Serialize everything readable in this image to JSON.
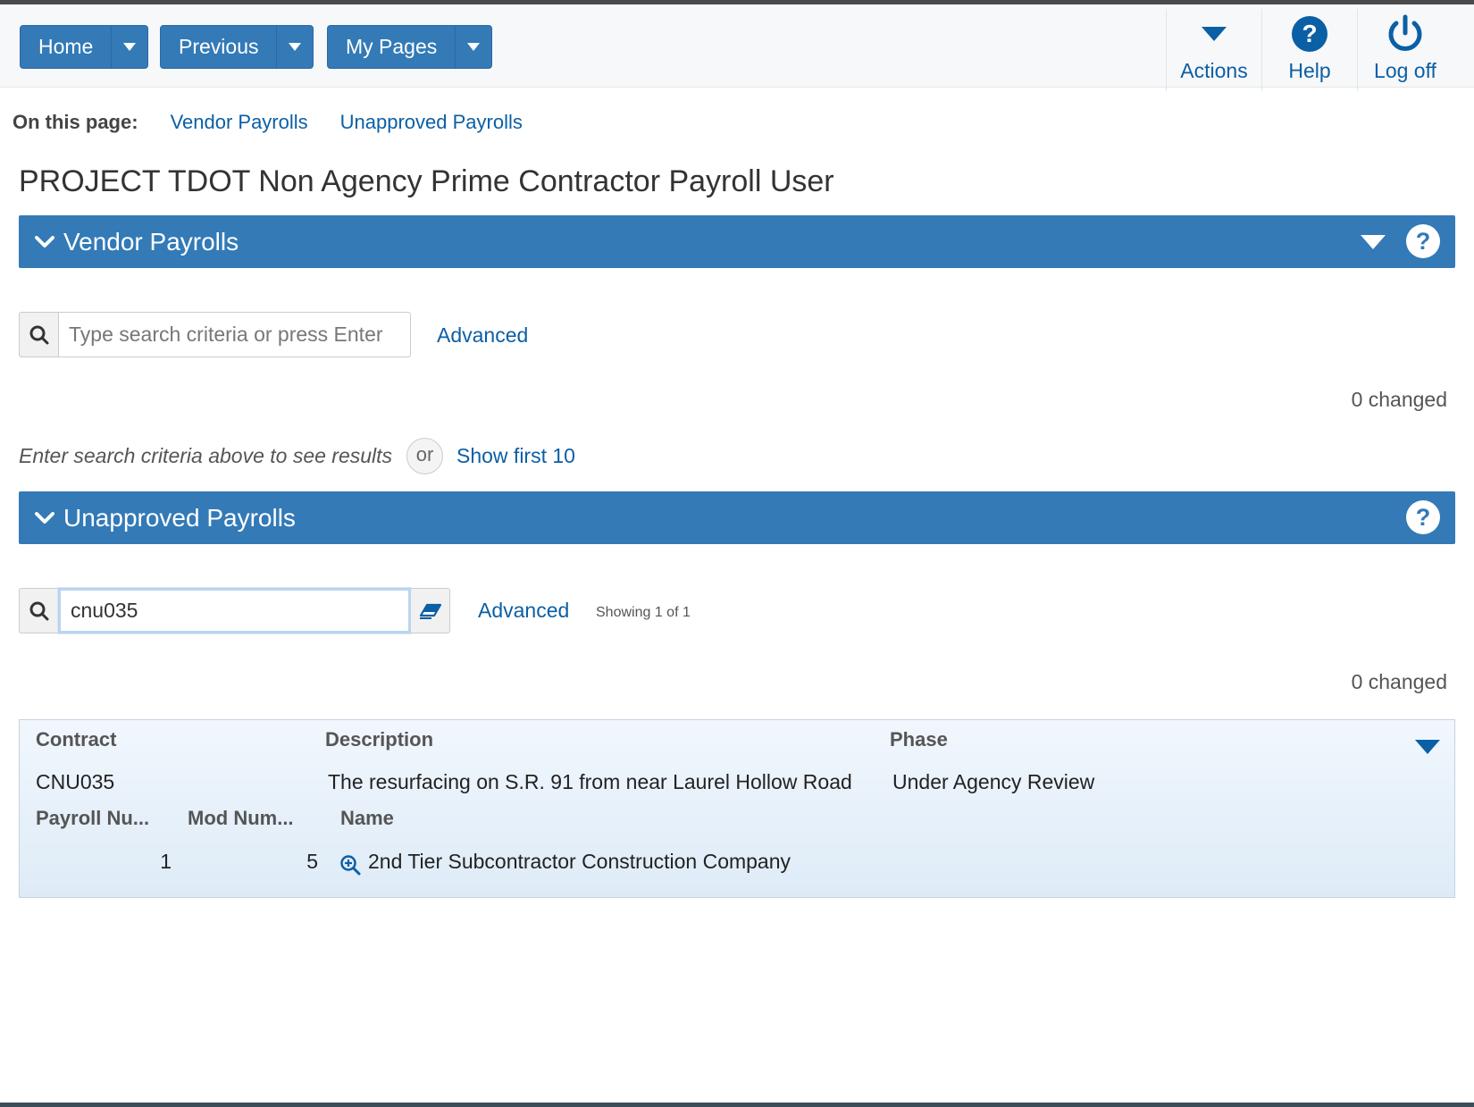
{
  "nav": {
    "home": "Home",
    "previous": "Previous",
    "my_pages": "My Pages"
  },
  "toolbar": {
    "actions": "Actions",
    "help": "Help",
    "logoff": "Log off"
  },
  "on_this_page": {
    "label": "On this page:",
    "links": [
      "Vendor Payrolls",
      "Unapproved Payrolls"
    ]
  },
  "page_title": "PROJECT TDOT Non Agency Prime Contractor Payroll User",
  "vendor_payrolls": {
    "title": "Vendor Payrolls",
    "search_placeholder": "Type search criteria or press Enter",
    "search_value": "",
    "advanced": "Advanced",
    "changed": "0 changed",
    "hint": "Enter search criteria above to see results",
    "or": "or",
    "show_first": "Show first 10"
  },
  "unapproved_payrolls": {
    "title": "Unapproved Payrolls",
    "search_value": "cnu035",
    "advanced": "Advanced",
    "showing": "Showing 1 of 1",
    "changed": "0 changed",
    "headers": {
      "contract": "Contract",
      "description": "Description",
      "phase": "Phase",
      "payroll_num": "Payroll Nu...",
      "mod_num": "Mod Num...",
      "name": "Name"
    },
    "rows": [
      {
        "contract": "CNU035",
        "description": "The resurfacing on S.R. 91 from near Laurel Hollow Road",
        "phase": "Under Agency Review",
        "payroll_num": "1",
        "mod_num": "5",
        "name": "2nd Tier Subcontractor Construction Company"
      }
    ]
  },
  "colors": {
    "primary": "#337ab7",
    "link": "#0b5fa5",
    "results_bg": "#e6f0fa"
  }
}
